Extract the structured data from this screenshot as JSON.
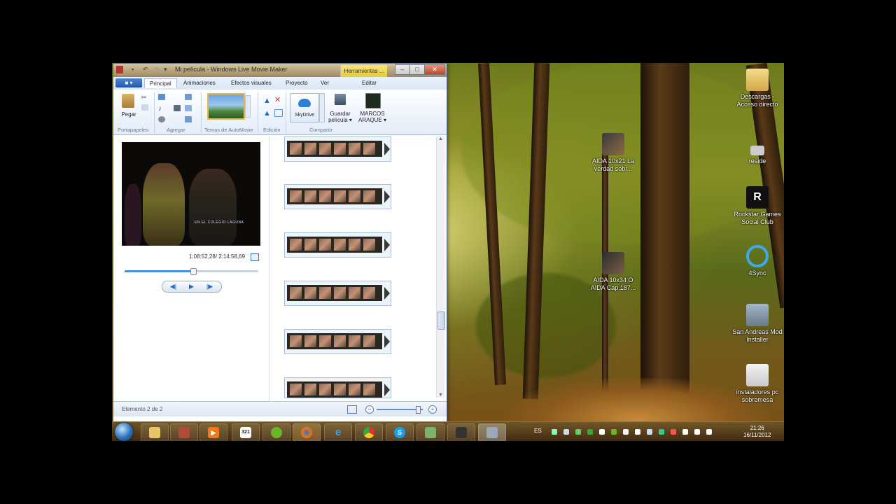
{
  "window": {
    "title": "Mi película - Windows Live Movie Maker",
    "contextual_tab": "Herramientas ...",
    "controls": {
      "minimize": "–",
      "maximize": "□",
      "close": "✕"
    }
  },
  "ribbon": {
    "app_menu": "▾",
    "tabs": [
      "Principal",
      "Animaciones",
      "Efectos visuales",
      "Proyecto",
      "Ver",
      "Editar"
    ],
    "paste_label": "Pegar",
    "groups": [
      "Portapapeles",
      "Agregar",
      "Temas de AutoMovie",
      "Edición",
      "Compartir"
    ],
    "skydrive_label": "SkyDrive",
    "save_movie_label": "Guardar película ▾",
    "sign_in_label": "MARCOS ARAQUE ▾"
  },
  "preview": {
    "subtitle_overlay": "EN EL COLEGIO LAGUNA",
    "timecode": "1:08:52,28/ 2:14:58,69",
    "seek_fraction": 0.51,
    "buttons": {
      "prev": "◀|",
      "play": "▶",
      "next": "|▶"
    }
  },
  "storyboard": {
    "clip_count": 6
  },
  "status": {
    "text": "Elemento 2 de 2",
    "zoom_fraction": 0.9
  },
  "desktop": {
    "icons": [
      {
        "label": "Descargas - Acceso directo",
        "name": "downloads-shortcut"
      },
      {
        "label": "AIDA 10x21 La verdad sobr...",
        "name": "video-file-aida-10x21"
      },
      {
        "label": "reside",
        "name": "reside-shortcut"
      },
      {
        "label": "Rockstar Games Social Club",
        "name": "rockstar-social-club"
      },
      {
        "label": "AIDA 10x34 O AIDA Cap.187...",
        "name": "video-file-aida-10x34"
      },
      {
        "label": "4Sync",
        "name": "4sync-shortcut"
      },
      {
        "label": "San Andreas Mod Installer",
        "name": "san-andreas-mod-installer"
      },
      {
        "label": "instaladores pc sobremesa",
        "name": "installers-folder"
      }
    ]
  },
  "taskbar": {
    "apps": [
      "explorer",
      "winrar",
      "media-player",
      "calendar-321",
      "spotify",
      "firefox",
      "internet-explorer",
      "chrome",
      "skype",
      "network",
      "device",
      "movie-maker"
    ],
    "calendar_label": "321",
    "language": "ES",
    "time": "21:26",
    "date": "16/11/2012"
  }
}
